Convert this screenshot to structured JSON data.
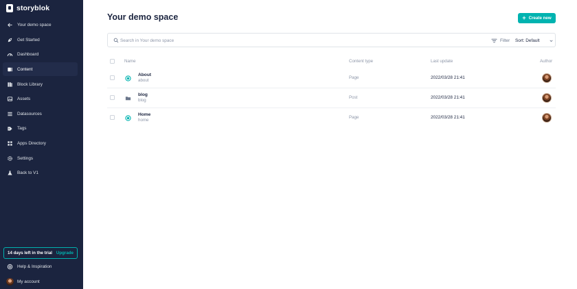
{
  "brand": {
    "name": "storyblok"
  },
  "sidebar": {
    "items": [
      {
        "label": "Your demo space",
        "icon": "arrow-left-icon"
      },
      {
        "label": "Get Started",
        "icon": "rocket-icon"
      },
      {
        "label": "Dashboard",
        "icon": "dashboard-icon"
      },
      {
        "label": "Content",
        "icon": "content-icon",
        "active": true
      },
      {
        "label": "Block Library",
        "icon": "block-library-icon"
      },
      {
        "label": "Assets",
        "icon": "assets-icon"
      },
      {
        "label": "Datasources",
        "icon": "datasources-icon"
      },
      {
        "label": "Tags",
        "icon": "tag-icon"
      },
      {
        "label": "Apps Directory",
        "icon": "apps-icon"
      },
      {
        "label": "Settings",
        "icon": "gear-icon"
      },
      {
        "label": "Back to V1",
        "icon": "flask-icon"
      }
    ],
    "trial": {
      "text": "14 days left in the trial",
      "upgrade": "Upgrade"
    },
    "help": {
      "label": "Help & Inspiration",
      "icon": "help-icon"
    },
    "account": {
      "label": "My account"
    }
  },
  "main": {
    "title": "Your demo space",
    "create_button": "Create new",
    "search_placeholder": "Search in Your demo space",
    "filter_label": "Filter",
    "sort_label": "Sort: Default",
    "columns": {
      "name": "Name",
      "content_type": "Content type",
      "last_update": "Last update",
      "author": "Author"
    },
    "rows": [
      {
        "name": "About",
        "slug": "about",
        "type": "Page",
        "date": "2022/03/28 21:41",
        "icon": "page-published-icon"
      },
      {
        "name": "blog",
        "slug": "blog",
        "type": "Post",
        "date": "2022/03/28 21:41",
        "icon": "folder-icon"
      },
      {
        "name": "Home",
        "slug": "home",
        "type": "Page",
        "date": "2022/03/28 21:41",
        "icon": "page-published-icon"
      }
    ]
  },
  "colors": {
    "sidebar": "#1b243f",
    "accent": "#00b3b0",
    "text": "#1b243f",
    "muted": "#8d96a8"
  }
}
